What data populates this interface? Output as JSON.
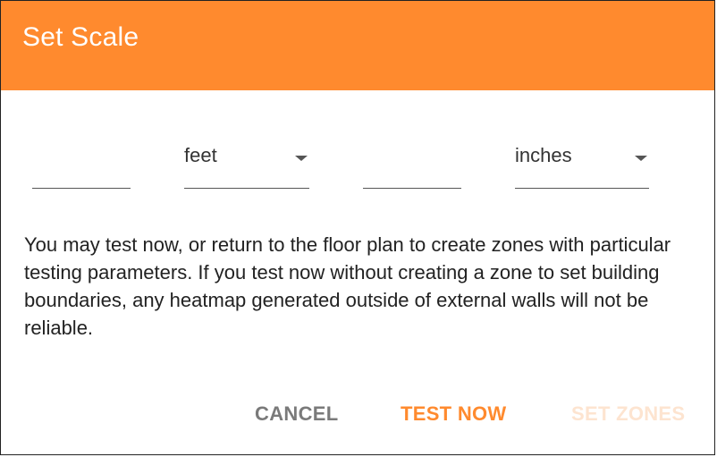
{
  "dialog": {
    "title": "Set Scale",
    "accent_color": "#ff8a2e"
  },
  "scale": {
    "distance_1": {
      "value": "",
      "placeholder": ""
    },
    "unit_1": {
      "selected": "feet"
    },
    "distance_2": {
      "value": "",
      "placeholder": ""
    },
    "unit_2": {
      "selected": "inches"
    }
  },
  "message": "You may test now, or return to the floor plan to create zones with particular testing parameters. If you test now without creating a zone to set building boundaries, any heatmap generated outside of external walls will not be reliable.",
  "actions": {
    "cancel_label": "CANCEL",
    "test_now_label": "TEST NOW",
    "set_zones_label": "SET ZONES",
    "set_zones_disabled": true
  }
}
